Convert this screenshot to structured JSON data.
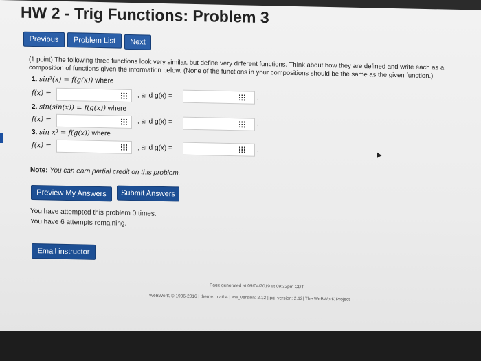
{
  "page_title": "HW 2 - Trig Functions: Problem 3",
  "nav": {
    "previous": "Previous",
    "problem_list": "Problem List",
    "next": "Next"
  },
  "problem": {
    "intro": "(1 point) The following three functions look very similar, but define very different functions. Think about how they are defined and write each as a composition of functions given the information below. (None of the functions in your compositions should be the same as the given function.)",
    "items": [
      {
        "number": "1.",
        "given": "sin³(x) = f(g(x))",
        "where": "where",
        "f_label": "f(x) =",
        "g_label": ", and g(x) =",
        "f_value": "",
        "g_value": ""
      },
      {
        "number": "2.",
        "given": "sin(sin(x)) = f(g(x))",
        "where": "where",
        "f_label": "f(x) =",
        "g_label": ", and g(x) =",
        "f_value": "",
        "g_value": ""
      },
      {
        "number": "3.",
        "given": "sin x³ = f(g(x))",
        "where": "where",
        "f_label": "f(x) =",
        "g_label": ", and g(x) =",
        "f_value": "",
        "g_value": ""
      }
    ],
    "period": "."
  },
  "note": {
    "label": "Note:",
    "text": "You can earn partial credit on this problem."
  },
  "actions": {
    "preview": "Preview My Answers",
    "submit": "Submit Answers"
  },
  "attempts": {
    "line1": "You have attempted this problem 0 times.",
    "line2": "You have 6 attempts remaining."
  },
  "email": "Email instructor",
  "footer": {
    "generated": "Page generated at 09/04/2019 at 09:32pm CDT",
    "credits": "WeBWorK © 1996-2016 | theme: math4 | ww_version: 2.12 | pg_version: 2.12| The WeBWorK Project"
  }
}
